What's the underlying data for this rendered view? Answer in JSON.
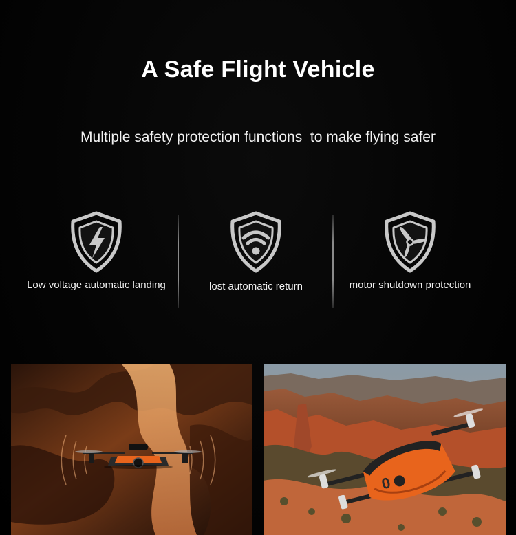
{
  "header": {
    "title": "A Safe Flight Vehicle",
    "subtitle": "Multiple safety protection functions  to make flying safer"
  },
  "features": [
    {
      "icon": "lightning-shield-icon",
      "label": "Low voltage automatic landing"
    },
    {
      "icon": "wifi-shield-icon",
      "label": "lost automatic return"
    },
    {
      "icon": "propeller-shield-icon",
      "label": "motor shutdown protection"
    }
  ],
  "colors": {
    "background": "#000000",
    "icon_outline": "#c8c8c8",
    "drone_orange": "#e8641c",
    "canyon_brown": "#6b3a1a",
    "canyon_red": "#b4502a"
  },
  "photos": [
    {
      "subject": "drone flying in slot canyon"
    },
    {
      "subject": "orange drone over red rock canyon landscape"
    }
  ]
}
